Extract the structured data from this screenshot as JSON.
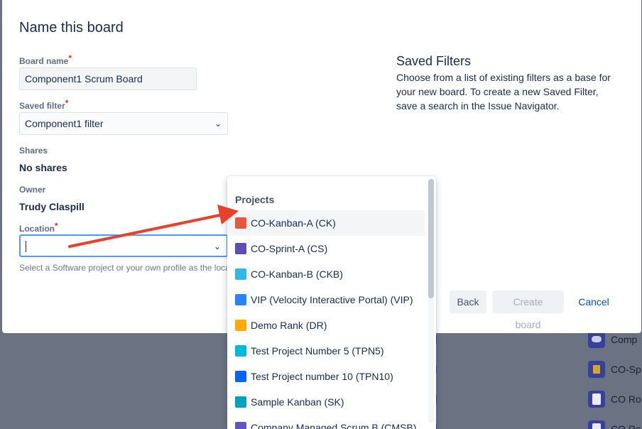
{
  "modal": {
    "title": "Name this board",
    "board_name": {
      "label": "Board name",
      "required_mark": "*",
      "value": "Component1 Scrum Board"
    },
    "saved_filter": {
      "label": "Saved filter",
      "required_mark": "*",
      "value": "Component1 filter"
    },
    "shares": {
      "label": "Shares",
      "value": "No shares"
    },
    "owner": {
      "label": "Owner",
      "value": "Trudy Claspill"
    },
    "location": {
      "label": "Location",
      "required_mark": "*",
      "value": "",
      "help": "Select a Software project or your own profile as the location"
    },
    "side_panel": {
      "title": "Saved Filters",
      "description": "Choose from a list of existing filters as a base for your new board. To create a new Saved Filter, save a search in the Issue Navigator."
    },
    "buttons": {
      "back": "Back",
      "create": "Create board",
      "cancel": "Cancel"
    }
  },
  "dropdown": {
    "heading": "Projects",
    "items": [
      {
        "label": "CO-Kanban-A (CK)",
        "icon": "project-kanban-icon",
        "color": "#e5583d"
      },
      {
        "label": "CO-Sprint-A (CS)",
        "icon": "project-sprint-icon",
        "color": "#5e4db2"
      },
      {
        "label": "CO-Kanban-B (CKB)",
        "icon": "project-kanban-b-icon",
        "color": "#2fb8e0"
      },
      {
        "label": "VIP (Velocity Interactive Portal) (VIP)",
        "icon": "project-vip-icon",
        "color": "#2684ff"
      },
      {
        "label": "Demo Rank (DR)",
        "icon": "project-demo-icon",
        "color": "#ffab00"
      },
      {
        "label": "Test Project Number 5 (TPN5)",
        "icon": "project-test5-icon",
        "color": "#00b8d9"
      },
      {
        "label": "Test Project number 10 (TPN10)",
        "icon": "project-test10-icon",
        "color": "#0065ff"
      },
      {
        "label": "Sample Kanban (SK)",
        "icon": "project-sample-icon",
        "color": "#00a3bf"
      },
      {
        "label": "Company Managed Scrum B (CMSB)",
        "icon": "project-cms-icon",
        "color": "#6554c0"
      }
    ]
  },
  "background": {
    "items": [
      "Comp",
      "CO-Sp",
      "CO Ro",
      "CO Ro"
    ]
  }
}
